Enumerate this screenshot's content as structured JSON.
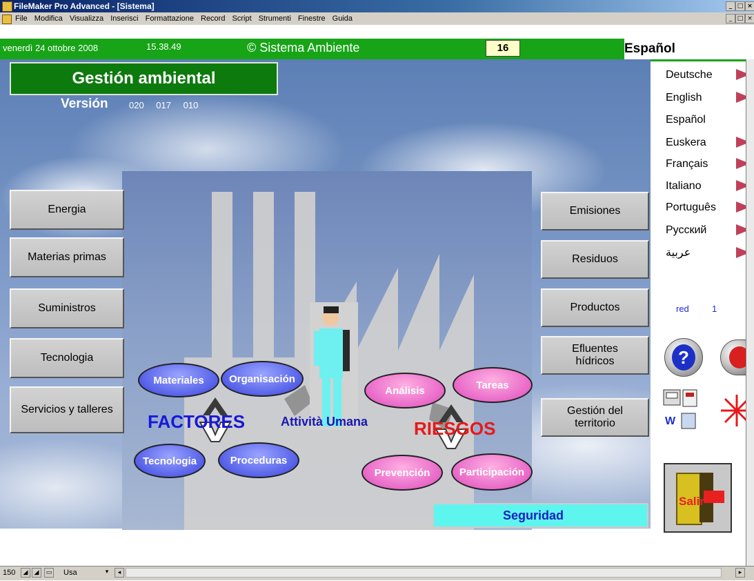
{
  "window": {
    "title": "FileMaker Pro Advanced - [Sistema]",
    "controls": [
      "_",
      "□",
      "×"
    ]
  },
  "menu": [
    "File",
    "Modifica",
    "Visualizza",
    "Inserisci",
    "Formattazione",
    "Record",
    "Script",
    "Strumenti",
    "Finestre",
    "Guida"
  ],
  "status": {
    "date": "venerdì 24 ottobre 2008",
    "time": "15.38.49",
    "copyright": "© Sistema Ambiente",
    "counter": "16",
    "current_language": "Español"
  },
  "header": {
    "title": "Gestión ambiental",
    "version_label": "Versión",
    "version_numbers": "020 017 010"
  },
  "left_buttons": [
    "Energia",
    "Materias primas",
    "Suministros",
    "Tecnologia",
    "Servicios y talleres"
  ],
  "right_buttons": [
    "Emisiones",
    "Residuos",
    "Productos",
    "Efluentes hídricos",
    "Gestión del territorio"
  ],
  "factors": {
    "label": "FACTORES",
    "items": [
      "Materiales",
      "Organisación",
      "Tecnologia",
      "Proceduras"
    ]
  },
  "center_label": "Attività Umana",
  "risks": {
    "label": "RIESGOS",
    "items": [
      "Análisis",
      "Tareas",
      "Prevención",
      "Participación"
    ]
  },
  "seguridad": "Seguridad",
  "languages": [
    {
      "name": "Deutsche",
      "arrow": true
    },
    {
      "name": "English",
      "arrow": true
    },
    {
      "name": "Español",
      "arrow": false
    },
    {
      "name": "Euskera",
      "arrow": true
    },
    {
      "name": "Français",
      "arrow": true
    },
    {
      "name": "Italiano",
      "arrow": true
    },
    {
      "name": "Português",
      "arrow": true
    },
    {
      "name": "Русский",
      "arrow": true
    },
    {
      "name": "عربية",
      "arrow": true
    }
  ],
  "network": {
    "label": "red",
    "value": "1"
  },
  "exit_label": "Salir",
  "bottom": {
    "zoom": "150",
    "mode": "Usa"
  },
  "colors": {
    "green": "#17a417",
    "title_green": "#0d7a0d",
    "blue_oval": "#5560e8",
    "pink_oval": "#e868c8",
    "seguridad_bg": "#5ef5ef"
  }
}
